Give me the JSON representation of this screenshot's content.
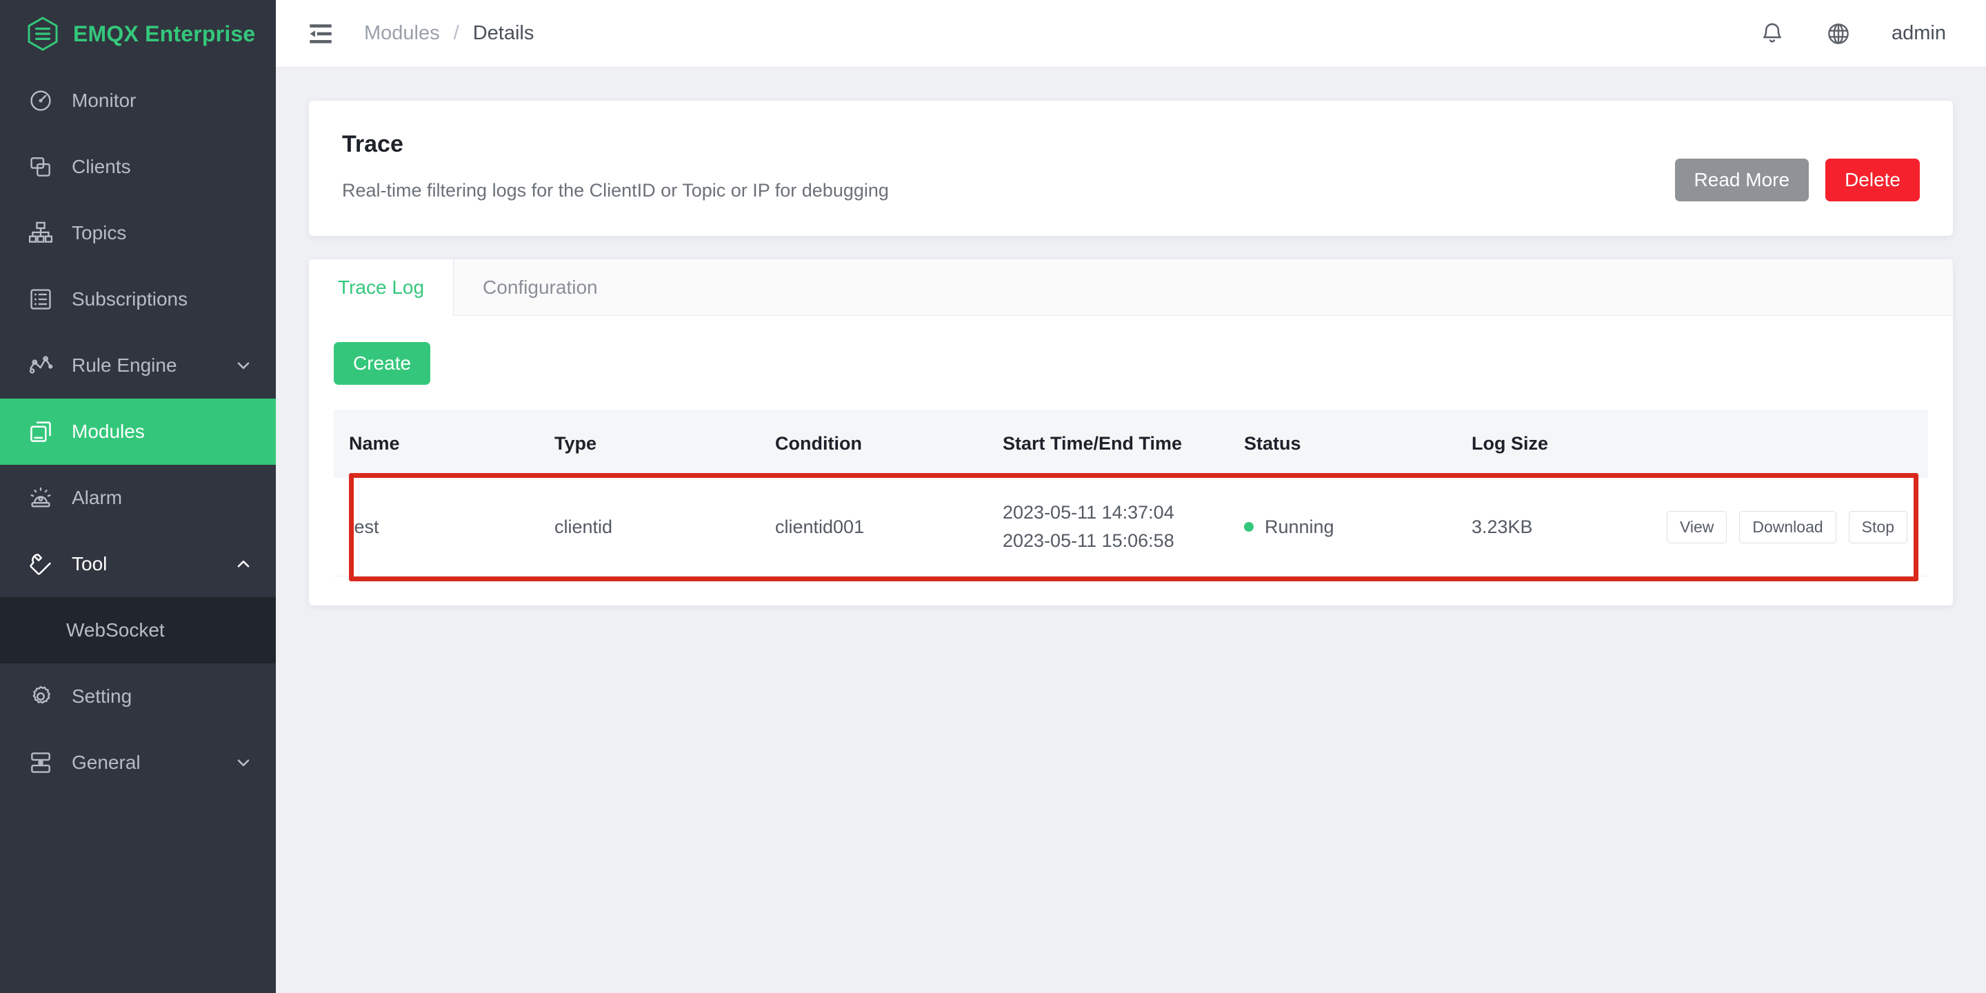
{
  "brand": {
    "name": "EMQX Enterprise",
    "logo_icon": "emqx-hexagon-logo",
    "accent": "#34c77b"
  },
  "sidebar": {
    "items": [
      {
        "label": "Monitor",
        "icon": "gauge-icon",
        "active": false,
        "caret": null
      },
      {
        "label": "Clients",
        "icon": "clients-icon",
        "active": false,
        "caret": null
      },
      {
        "label": "Topics",
        "icon": "topics-tree-icon",
        "active": false,
        "caret": null
      },
      {
        "label": "Subscriptions",
        "icon": "subscriptions-icon",
        "active": false,
        "caret": null
      },
      {
        "label": "Rule Engine",
        "icon": "rule-engine-icon",
        "active": false,
        "caret": "chevron-down-icon"
      },
      {
        "label": "Modules",
        "icon": "modules-icon",
        "active": true,
        "caret": null
      },
      {
        "label": "Alarm",
        "icon": "alarm-icon",
        "active": false,
        "caret": null
      },
      {
        "label": "Tool",
        "icon": "wrench-icon",
        "active": false,
        "caret": "chevron-up-icon",
        "expanded": true,
        "children": [
          {
            "label": "WebSocket"
          }
        ]
      },
      {
        "label": "Setting",
        "icon": "gear-icon",
        "active": false,
        "caret": null
      },
      {
        "label": "General",
        "icon": "general-icon",
        "active": false,
        "caret": "chevron-down-icon"
      }
    ]
  },
  "topbar": {
    "collapse_icon": "collapse-sidebar-icon",
    "breadcrumb": {
      "parent": "Modules",
      "separator": "/",
      "current": "Details"
    },
    "bell_icon": "bell-icon",
    "globe_icon": "globe-icon",
    "user": "admin"
  },
  "trace_card": {
    "title": "Trace",
    "description": "Real-time filtering logs for the ClientID or Topic or IP for debugging",
    "read_more_label": "Read More",
    "delete_label": "Delete",
    "read_more_color": "#8f9297",
    "delete_color": "#f5222d"
  },
  "log_card": {
    "tabs": [
      {
        "label": "Trace Log",
        "active": true
      },
      {
        "label": "Configuration",
        "active": false
      }
    ],
    "create_label": "Create",
    "table": {
      "columns": [
        "Name",
        "Type",
        "Condition",
        "Start Time/End Time",
        "Status",
        "Log Size",
        ""
      ],
      "rows": [
        {
          "name": "test",
          "type": "clientid",
          "condition": "clientid001",
          "start_time": "2023-05-11 14:37:04",
          "end_time": "2023-05-11 15:06:58",
          "status": "Running",
          "status_color": "#34c77b",
          "log_size": "3.23KB",
          "actions": [
            "View",
            "Download",
            "Stop"
          ],
          "highlighted": true,
          "highlight_color": "#d9291c"
        }
      ]
    }
  }
}
